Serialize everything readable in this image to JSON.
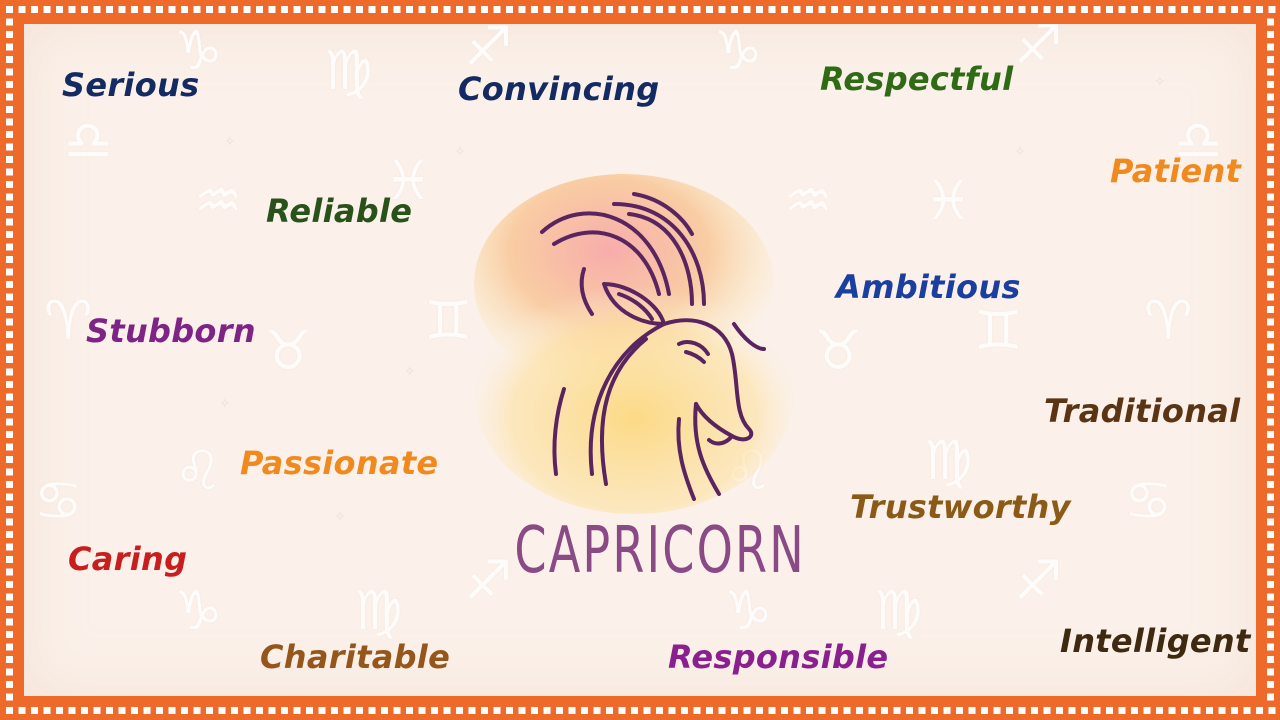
{
  "sign": {
    "name": "CAPRICORN",
    "icon": "capricorn-goat-icon"
  },
  "traits": [
    {
      "label": "Serious",
      "color": "#142a63"
    },
    {
      "label": "Convincing",
      "color": "#142a63"
    },
    {
      "label": "Respectful",
      "color": "#2f6a14"
    },
    {
      "label": "Patient",
      "color": "#f08a1e"
    },
    {
      "label": "Reliable",
      "color": "#285219"
    },
    {
      "label": "Ambitious",
      "color": "#1b3fa0"
    },
    {
      "label": "Stubborn",
      "color": "#7d2486"
    },
    {
      "label": "Traditional",
      "color": "#5b3414"
    },
    {
      "label": "Passionate",
      "color": "#f08a1e"
    },
    {
      "label": "Trustworthy",
      "color": "#8a5a16"
    },
    {
      "label": "Caring",
      "color": "#c81e1e"
    },
    {
      "label": "Charitable",
      "color": "#94561b"
    },
    {
      "label": "Responsible",
      "color": "#8a1f8e"
    },
    {
      "label": "Intelligent",
      "color": "#3e2a10"
    }
  ],
  "colors": {
    "border": "#ee6a2b",
    "background": "#fbf1ea",
    "sign_name": "#8a4a86",
    "illustration_stroke": "#5a2460"
  },
  "background_symbols": [
    "♑",
    "♐",
    "♍",
    "♎",
    "♓",
    "♈",
    "♊",
    "♉",
    "♌",
    "♋",
    "♏",
    "♒"
  ]
}
